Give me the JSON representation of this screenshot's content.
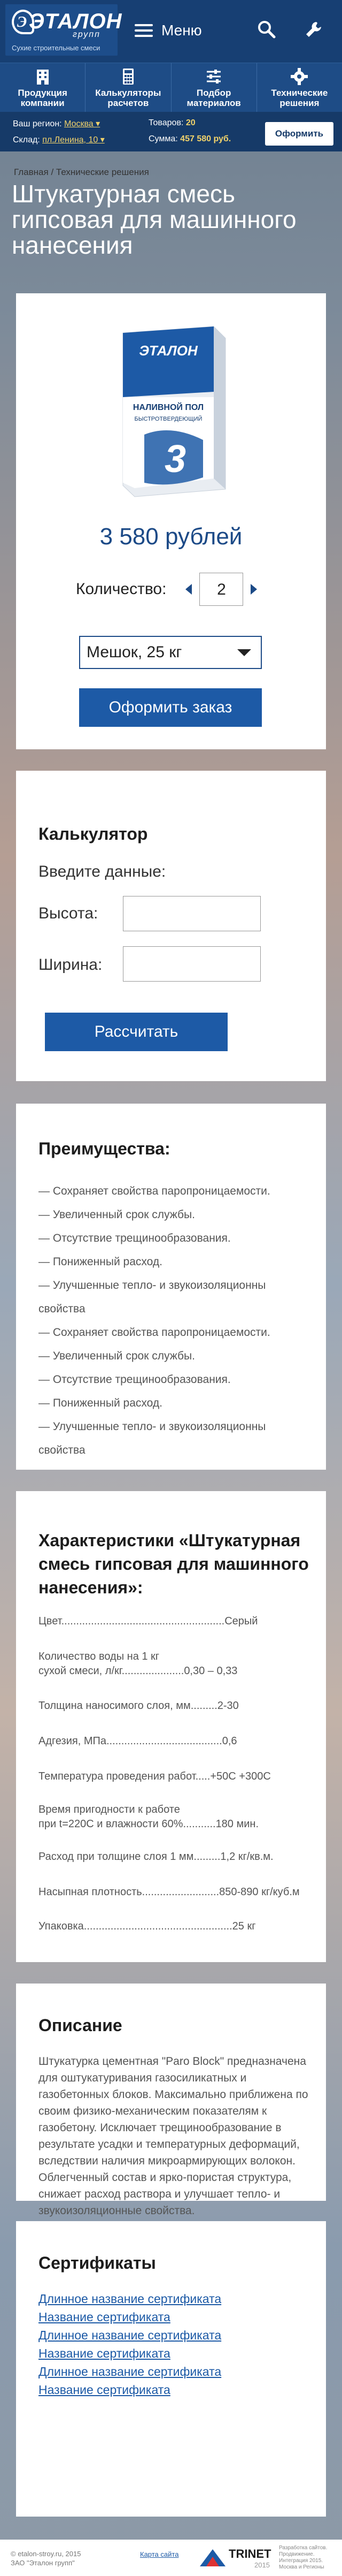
{
  "header": {
    "logo_text": "ЭТАЛОН",
    "logo_sub": "групп",
    "logo_tagline": "Сухие строительные смеси",
    "menu_label": "Меню",
    "search_icon": "search-icon",
    "tools_icon": "wrench-icon"
  },
  "nav": [
    {
      "icon": "building-icon",
      "label": "Продукция компании"
    },
    {
      "icon": "calculator-icon",
      "label": "Калькуляторы расчетов"
    },
    {
      "icon": "sliders-icon",
      "label": "Подбор материалов"
    },
    {
      "icon": "gear-icon",
      "label": "Технические решения"
    }
  ],
  "info": {
    "region_label": "Ваш регион:",
    "region_value": "Москва ▾",
    "warehouse_label": "Склад:",
    "warehouse_value": "пл.Ленина, 10 ▾",
    "goods_label": "Товаров:",
    "goods_value": "20",
    "sum_label": "Сумма:",
    "sum_value": "457 580 руб.",
    "order_button": "Оформить"
  },
  "breadcrumbs": {
    "home": "Главная",
    "separator": " / ",
    "current": "Технические решения"
  },
  "page_title": "Штукатурная смесь гипсовая для машинного нанесения",
  "product": {
    "bag_brand": "ЭТАЛОН",
    "bag_title": "НАЛИВНОЙ ПОЛ",
    "bag_subtitle": "БЫСТРОТВЕРДЕЮЩИЙ",
    "bag_number": "3",
    "price": "3 580 рублей",
    "qty_label": "Количество:",
    "qty_value": "2",
    "package_value": "Мешок,  25 кг",
    "order_button": "Оформить заказ"
  },
  "calculator": {
    "title": "Калькулятор",
    "intro": "Введите данные:",
    "height_label": "Высота:",
    "width_label": "Ширина:",
    "button": "Рассчитать"
  },
  "advantages": {
    "title": "Преимущества:",
    "items": [
      "— Сохраняет свойства паропроницаемости.",
      "— Увеличенный срок службы.",
      "— Отсутствие трещинообразования.",
      "— Пониженный расход.",
      "— Улучшенные тепло- и звукоизоляционны",
      "свойства",
      "— Сохраняет свойства паропроницаемости.",
      "— Увеличенный срок службы.",
      "— Отсутствие трещинообразования.",
      "— Пониженный расход.",
      "— Улучшенные тепло- и звукоизоляционны",
      "свойства"
    ]
  },
  "specs": {
    "title": "Характеристики «Штукатурная смесь гипсовая для машинного нанесения»:",
    "rows": [
      [
        "Цвет.......................................................",
        "Серый"
      ],
      [
        "Количество воды на 1 кг\nсухой смеси, л/кг.....................",
        "0,30 – 0,33"
      ],
      [
        "Толщина наносимого слоя, мм.........",
        "2-30"
      ],
      [
        "Адгезия, МПа.......................................",
        "0,6"
      ],
      [
        "Температура проведения работ.....",
        "+50С +300С"
      ],
      [
        "Время пригодности к работе\nпри t=220С и влажности 60%...........",
        "180 мин."
      ],
      [
        "Расход при толщине слоя 1 мм.........",
        "1,2 кг/кв.м."
      ],
      [
        "Насыпная плотность..........................",
        "850-890 кг/куб.м"
      ],
      [
        "Упаковка..................................................",
        "25 кг"
      ]
    ]
  },
  "description": {
    "title": "Описание",
    "text": "Штукатурка цементная \"Paro Block\" предназначена для оштукатуривания газосиликатных и газобетонных блоков. Максимально приближена по своим физико-механическим показателям к газобетону. Исключает трещинообразование в результате усадки и температурных деформаций, вследствии наличия микроармирующих волокон. Облегченный состав и ярко-пористая структура, снижает расход раствора и улучшает тепло- и звукоизоляционные свойства."
  },
  "certificates": {
    "title": "Сертификаты",
    "items": [
      "Длинное название сертификата",
      "Название сертификата",
      "Длинное название сертификата",
      "Название сертификата",
      "Длинное название сертификата",
      "Название сертификата"
    ]
  },
  "footer": {
    "copyright": "© etalon-stroy.ru, 2015",
    "company": "ЗАО \"Эталон групп\"",
    "sitemap": "Карта сайта",
    "dev_brand": "TRINET",
    "dev_year": "2015",
    "dev_note": "Разработка сайтов. Продвижение. Интеграция 2015. Москва и Регионы"
  },
  "colors": {
    "header_bg": "#173f73",
    "nav_bg": "#1e4c86",
    "accent_blue": "#1d5aa6",
    "highlight": "#f2d36b"
  }
}
